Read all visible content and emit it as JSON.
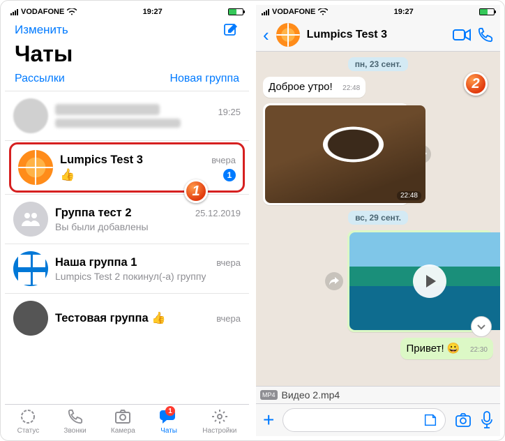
{
  "status": {
    "carrier": "VODAFONE",
    "time": "19:27"
  },
  "left": {
    "edit": "Изменить",
    "title": "Чаты",
    "broadcasts": "Рассылки",
    "newgroup": "Новая группа",
    "rows": [
      {
        "name": "██████████",
        "msg": "████████████████",
        "time": "19:25"
      },
      {
        "name": "Lumpics Test 3",
        "msg": "👍",
        "time": "вчера",
        "unread": "1"
      },
      {
        "name": "Группа тест 2",
        "msg": "Вы были добавлены",
        "time": "25.12.2019"
      },
      {
        "name": "Наша группа 1",
        "msg": "Lumpics Test 2 покинул(-а) группу",
        "time": "вчера"
      },
      {
        "name_pre": "Тестовая группа ",
        "emoji": "👍",
        "msg": "",
        "time": "вчера"
      }
    ],
    "tabs": {
      "status": "Статус",
      "calls": "Звонки",
      "camera": "Камера",
      "chats": "Чаты",
      "settings": "Настройки",
      "badge": "1"
    }
  },
  "right": {
    "title": "Lumpics Test 3",
    "dates": {
      "d1": "пн, 23 сент.",
      "d2": "вс, 29 сент."
    },
    "msgs": {
      "m1": {
        "text": "Доброе утро!",
        "time": "22:48"
      },
      "img1": {
        "time": "22:48"
      },
      "m3": {
        "text": "Привет! 😀",
        "time": "22:30"
      },
      "file": {
        "ext": "MP4",
        "name": "Видео 2.mp4"
      }
    }
  },
  "steps": {
    "s1": "1",
    "s2": "2"
  }
}
